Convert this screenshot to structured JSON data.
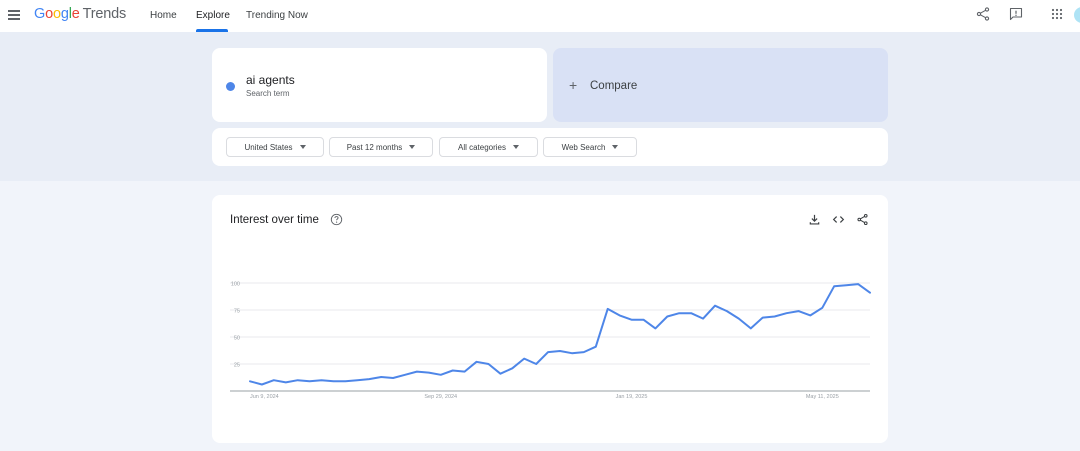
{
  "header": {
    "logo_google": [
      "G",
      "o",
      "o",
      "g",
      "l",
      "e"
    ],
    "logo_trends": "Trends",
    "tabs": [
      {
        "label": "Home"
      },
      {
        "label": "Explore"
      },
      {
        "label": "Trending Now"
      }
    ],
    "active_tab": "Explore"
  },
  "search": {
    "term": "ai agents",
    "term_type": "Search term",
    "term_color": "#4e86e8",
    "compare_label": "Compare"
  },
  "filters": [
    {
      "label": "United States"
    },
    {
      "label": "Past 12 months"
    },
    {
      "label": "All categories"
    },
    {
      "label": "Web Search"
    }
  ],
  "chart_card": {
    "title": "Interest over time"
  },
  "colors": {
    "accent": "#1a73e8",
    "line": "#4e86e8",
    "band": "#e8edf6",
    "compare": "#d9e1f5"
  },
  "chart_data": {
    "type": "line",
    "title": "Interest over time",
    "xlabel": "",
    "ylabel": "",
    "ylim": [
      0,
      100
    ],
    "yticks": [
      25,
      50,
      75,
      100
    ],
    "grid": true,
    "x_tick_labels": [
      {
        "label": "Jun 9, 2024",
        "index": 0
      },
      {
        "label": "Sep 29, 2024",
        "index": 16
      },
      {
        "label": "Jan 19, 2025",
        "index": 32
      },
      {
        "label": "May 11, 2025",
        "index": 48
      }
    ],
    "series": [
      {
        "color": "#4e86e8",
        "values": [
          9,
          6,
          10,
          8,
          10,
          9,
          10,
          9,
          9,
          10,
          11,
          13,
          12,
          15,
          18,
          17,
          15,
          19,
          18,
          27,
          25,
          16,
          21,
          30,
          25,
          36,
          37,
          35,
          36,
          41,
          76,
          70,
          66,
          66,
          58,
          69,
          72,
          72,
          67,
          79,
          74,
          67,
          58,
          68,
          69,
          72,
          74,
          70,
          77,
          97,
          98,
          99,
          91
        ]
      }
    ]
  }
}
